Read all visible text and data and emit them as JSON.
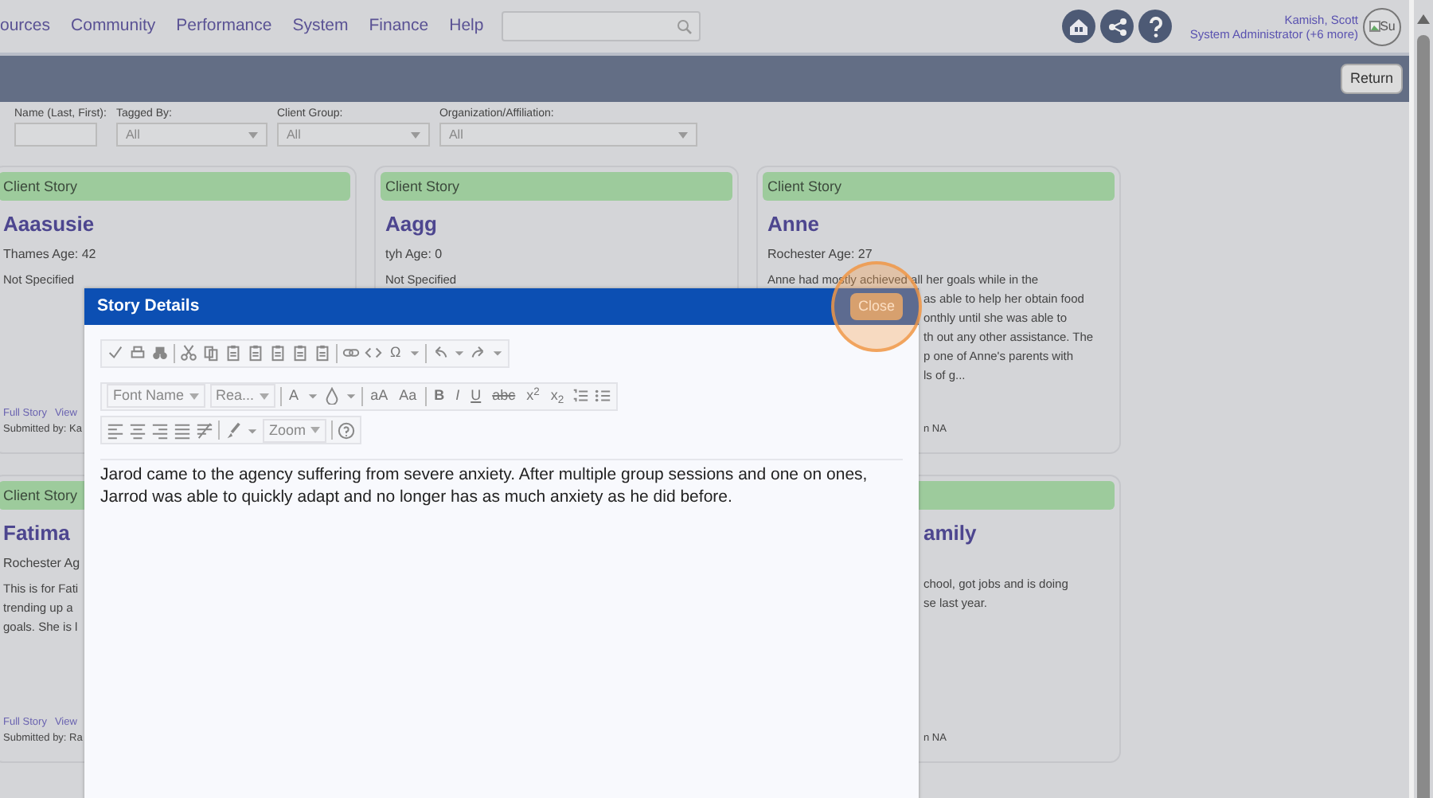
{
  "nav": {
    "menu": [
      {
        "label": "ources"
      },
      {
        "label": "Community"
      },
      {
        "label": "Performance"
      },
      {
        "label": "System"
      },
      {
        "label": "Finance"
      },
      {
        "label": "Help"
      }
    ]
  },
  "user": {
    "name": "Kamish, Scott",
    "role": "System Administrator (+6 more)",
    "avatar_text": "Su"
  },
  "band": {
    "button": "Return"
  },
  "filters": [
    {
      "kind": "text",
      "label": "Name (Last, First):"
    },
    {
      "kind": "select",
      "label": "Tagged By:",
      "value": "All"
    },
    {
      "kind": "select",
      "label": "Client Group:",
      "value": "All"
    },
    {
      "kind": "select",
      "label": "Organization/Affiliation:",
      "value": "All"
    }
  ],
  "card_rows": [
    [
      {
        "header": "Client Story",
        "name": "Aaasusie",
        "meta": "Thames  Age: 42",
        "lines": [
          {
            "kind": "full",
            "text": "Not Specified"
          }
        ],
        "links": [
          "Full Story",
          "View"
        ],
        "submitted": "Submitted by: Ka"
      },
      {
        "header": "Client Story",
        "name": "Aagg",
        "meta": "tyh  Age: 0",
        "lines": [
          {
            "kind": "full",
            "text": "Not Specified"
          }
        ]
      },
      {
        "header": "Client Story",
        "name": "Anne",
        "meta": "Rochester  Age: 27",
        "lines": [
          {
            "kind": "full",
            "text": "Anne had mostly achieved all her goals while in the"
          },
          {
            "kind": "tail",
            "text": "as able to help her obtain food"
          },
          {
            "kind": "tail",
            "text": "onthly until she was able to"
          },
          {
            "kind": "tail",
            "text": "th out any other assistance. The"
          },
          {
            "kind": "tail",
            "text": "p one of Anne's parents with"
          },
          {
            "kind": "tail",
            "text": "ls of g..."
          }
        ],
        "footer": {
          "kind": "tail",
          "text": "n NA"
        }
      }
    ],
    [
      {
        "header": "Client Story",
        "name": "Fatima",
        "meta": "Rochester  Ag",
        "lines": [
          {
            "kind": "full",
            "text": "This is for Fati"
          },
          {
            "kind": "full",
            "text": "trending up a"
          },
          {
            "kind": "full",
            "text": "goals.  She is l"
          }
        ],
        "links": [
          "Full Story",
          "View"
        ],
        "submitted": "Submitted by: Ra"
      },
      null,
      {
        "kind": "covered",
        "name": "amily",
        "lines": [
          {
            "kind": "gap"
          },
          {
            "kind": "tail",
            "text": "chool, got jobs and is doing"
          },
          {
            "kind": "tail",
            "text": "se last year."
          }
        ],
        "footer": {
          "kind": "tail",
          "text": "n NA"
        }
      }
    ]
  ],
  "modal": {
    "title": "Story Details",
    "close": "Close",
    "toolbar": [
      [
        {
          "kind": "icon"
        },
        {
          "kind": "icon"
        },
        {
          "kind": "icon"
        },
        {
          "kind": "sep"
        },
        {
          "kind": "icon"
        },
        {
          "kind": "icon"
        },
        {
          "kind": "icon"
        },
        {
          "kind": "icon"
        },
        {
          "kind": "icon"
        },
        {
          "kind": "icon"
        },
        {
          "kind": "icon"
        },
        {
          "kind": "sep"
        },
        {
          "kind": "icon"
        },
        {
          "kind": "icon"
        },
        {
          "kind": "glyph",
          "text": "Ω"
        },
        {
          "kind": "icon"
        },
        {
          "kind": "sep"
        },
        {
          "kind": "icon"
        },
        {
          "kind": "icon"
        },
        {
          "kind": "icon"
        },
        {
          "kind": "icon"
        }
      ],
      [
        {
          "kind": "dropdown",
          "label": "Font Name"
        },
        {
          "kind": "dropdown",
          "label": "Rea..."
        },
        {
          "kind": "sep"
        },
        {
          "kind": "glyph",
          "text": "A"
        },
        {
          "kind": "icon"
        },
        {
          "kind": "icon"
        },
        {
          "kind": "icon"
        },
        {
          "kind": "sep"
        },
        {
          "kind": "glyph",
          "text": "aA"
        },
        {
          "kind": "glyph",
          "text": "Aa"
        },
        {
          "kind": "sep"
        },
        {
          "kind": "glyph",
          "text": "B"
        },
        {
          "kind": "glyph",
          "text": "I"
        },
        {
          "kind": "glyph",
          "text": "U"
        },
        {
          "kind": "glyph",
          "text": "abc"
        },
        {
          "kind": "glyph",
          "text": "x$^{2}$"
        },
        {
          "kind": "glyph",
          "text": "x$_{2}$"
        },
        {
          "kind": "icon"
        },
        {
          "kind": "icon"
        }
      ],
      [
        {
          "kind": "icon"
        },
        {
          "kind": "icon"
        },
        {
          "kind": "icon"
        },
        {
          "kind": "icon"
        },
        {
          "kind": "icon"
        },
        {
          "kind": "sep"
        },
        {
          "kind": "icon"
        },
        {
          "kind": "icon"
        },
        {
          "kind": "dropdown",
          "label": "Zoom"
        },
        {
          "kind": "sep"
        },
        {
          "kind": "icon"
        }
      ]
    ],
    "content": "Jarod came to the agency suffering from severe anxiety. After multiple group sessions and one on ones, Jarrod was able to quickly adapt and no longer has as much anxiety as he did before."
  }
}
